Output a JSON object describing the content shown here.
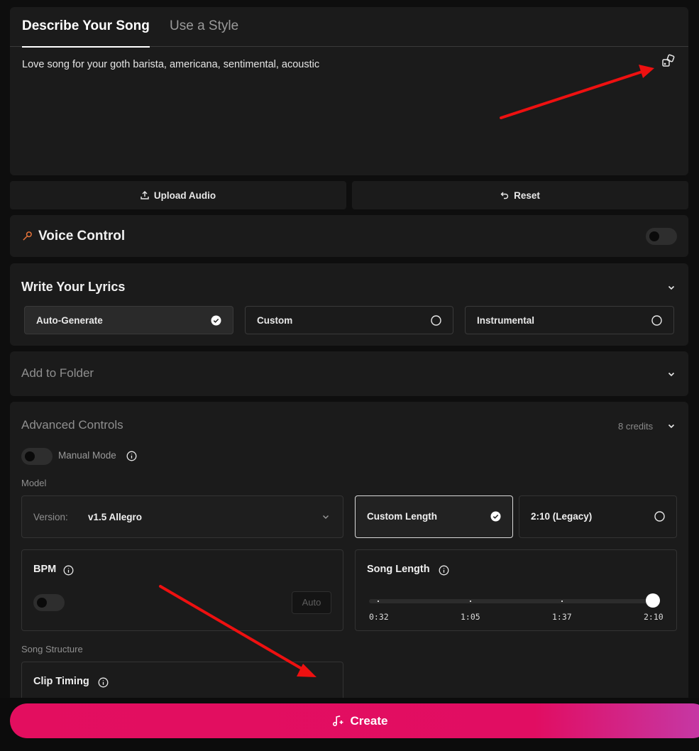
{
  "tabs": [
    {
      "label": "Describe Your Song",
      "active": true
    },
    {
      "label": "Use a Style",
      "active": false
    }
  ],
  "prompt": {
    "value": "Love song for your goth barista, americana, sentimental, acoustic",
    "icon": "dice-icon"
  },
  "actions": {
    "upload_label": "Upload Audio",
    "reset_label": "Reset"
  },
  "voice_control": {
    "title": "Voice Control",
    "enabled": false,
    "accent_color": "#e8743b"
  },
  "lyrics": {
    "title": "Write Your Lyrics",
    "options": [
      {
        "label": "Auto-Generate",
        "selected": true
      },
      {
        "label": "Custom",
        "selected": false
      },
      {
        "label": "Instrumental",
        "selected": false
      }
    ]
  },
  "folder": {
    "title": "Add to Folder"
  },
  "advanced": {
    "title": "Advanced Controls",
    "credits": "8 credits",
    "manual_mode_label": "Manual Mode",
    "manual_mode_enabled": false,
    "model_label": "Model",
    "version_label": "Version:",
    "version_value": "v1.5 Allegro",
    "length_options": [
      {
        "label": "Custom Length",
        "selected": true
      },
      {
        "label": "2:10 (Legacy)",
        "selected": false
      }
    ],
    "bpm": {
      "title": "BPM",
      "enabled": false,
      "auto_label": "Auto"
    },
    "song_length": {
      "title": "Song Length",
      "ticks": [
        "0:32",
        "1:05",
        "1:37",
        "2:10"
      ],
      "value": "2:10"
    },
    "song_structure_label": "Song Structure",
    "clip_timing_title": "Clip Timing"
  },
  "create": {
    "label": "Create",
    "color": "#e30e5f"
  }
}
